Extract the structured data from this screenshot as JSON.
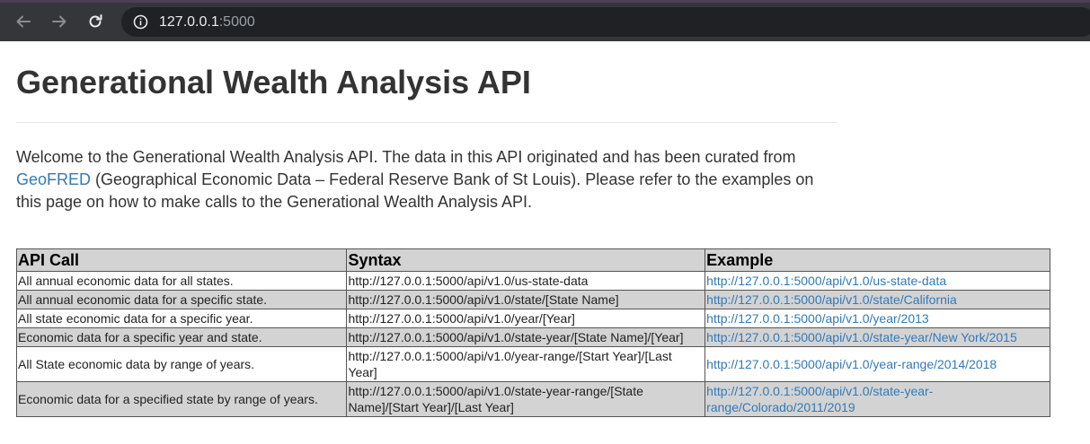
{
  "browser": {
    "url_host": "127.0.0.1",
    "url_port": ":5000",
    "back_icon": "arrow-left-icon",
    "forward_icon": "arrow-right-icon",
    "reload_icon": "reload-icon",
    "info_icon": "info-icon"
  },
  "page": {
    "title": "Generational Wealth Analysis API",
    "intro_before_link": "Welcome to the Generational Wealth Analysis API. The data in this API originated and has been curated from ",
    "intro_link": "GeoFRED",
    "intro_after_link": " (Geographical Economic Data – Federal Reserve Bank of St Louis). Please refer to the examples on this page on how to make calls to the Generational Wealth Analysis API."
  },
  "table": {
    "headers": [
      "API Call",
      "Syntax",
      "Example"
    ],
    "rows": [
      {
        "call": "All annual economic data for all states.",
        "syntax": "http://127.0.0.1:5000/api/v1.0/us-state-data",
        "example": "http://127.0.0.1:5000/api/v1.0/us-state-data"
      },
      {
        "call": "All annual economic data for a specific state.",
        "syntax": "http://127.0.0.1:5000/api/v1.0/state/[State Name]",
        "example": "http://127.0.0.1:5000/api/v1.0/state/California"
      },
      {
        "call": "All state economic data for a specific year.",
        "syntax": "http://127.0.0.1:5000/api/v1.0/year/[Year]",
        "example": "http://127.0.0.1:5000/api/v1.0/year/2013"
      },
      {
        "call": "Economic data for a specific year and state.",
        "syntax": "http://127.0.0.1:5000/api/v1.0/state-year/[State Name]/[Year]",
        "example": "http://127.0.0.1:5000/api/v1.0/state-year/New York/2015"
      },
      {
        "call": "All State economic data by range of years.",
        "syntax": "http://127.0.0.1:5000/api/v1.0/year-range/[Start Year]/[Last Year]",
        "example": "http://127.0.0.1:5000/api/v1.0/year-range/2014/2018"
      },
      {
        "call": "Economic data for a specified state by range of years.",
        "syntax": "http://127.0.0.1:5000/api/v1.0/state-year-range/[State Name]/[Start Year]/[Last Year]",
        "example": "http://127.0.0.1:5000/api/v1.0/state-year-range/Colorado/2011/2019"
      }
    ]
  },
  "colors": {
    "link": "#337ab7",
    "row_shade": "#d3d3d3",
    "browser_bar": "#35363a"
  }
}
